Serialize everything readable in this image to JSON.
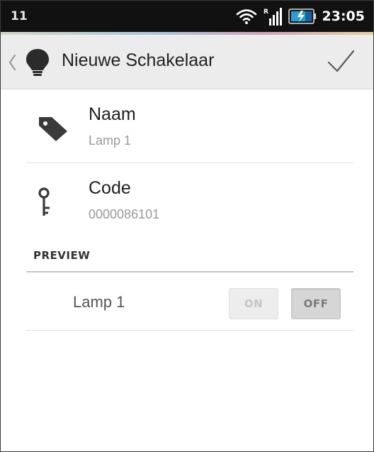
{
  "status_bar": {
    "notification_count": "11",
    "network_type": "R",
    "time": "23:05",
    "icons": [
      "wifi-icon",
      "signal-icon",
      "battery-icon"
    ]
  },
  "action_bar": {
    "title": "Nieuwe Schakelaar",
    "icons": [
      "back-chevron-icon",
      "lightbulb-icon",
      "checkmark-icon"
    ]
  },
  "fields": {
    "name": {
      "label": "Naam",
      "value": "Lamp 1",
      "icon": "tag-icon"
    },
    "code": {
      "label": "Code",
      "value": "0000086101",
      "icon": "key-icon"
    }
  },
  "preview": {
    "section_label": "PREVIEW",
    "device_label": "Lamp 1",
    "on_label": "ON",
    "off_label": "OFF",
    "selected": "OFF"
  },
  "colors": {
    "status_bar": "#111111",
    "action_bar": "#ececec",
    "icon": "#333333",
    "secondary_text": "#9a9a9a"
  }
}
